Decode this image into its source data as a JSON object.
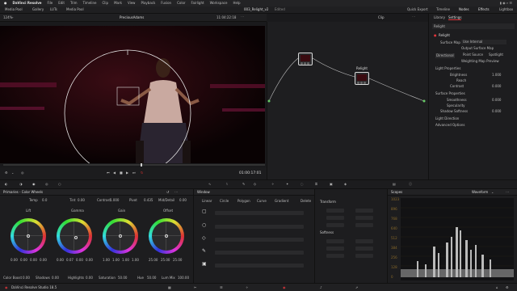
{
  "macbar": {
    "app_name": "DaVinci Resolve",
    "menus": [
      "File",
      "Edit",
      "Trim",
      "Timeline",
      "Clip",
      "Mark",
      "View",
      "Playback",
      "Fusion",
      "Color",
      "Fairlight",
      "Workspace",
      "Help"
    ]
  },
  "topbar": {
    "items": [
      "Media Pool",
      "Gallery",
      "LUTs",
      "Media Pool"
    ],
    "project_title": "003_Relight_v2",
    "project_status": "Edited",
    "right_tabs": [
      "Quick Export",
      "Timeline",
      "Nodes",
      "Effects",
      "Lightbox"
    ]
  },
  "viewer": {
    "zoom": "124%",
    "clip_name": "PreciousAdams",
    "timecode_top": "11:04:22:18",
    "mode": "Clip",
    "timecode": "01:00:17:01"
  },
  "right_panel": {
    "tabs": [
      "Library",
      "Settings"
    ],
    "search_label": "Relight",
    "section_title": "Relight",
    "surface_map_label": "Surface Map",
    "surface_map_value": "Use Internal",
    "output_surface_map": "Output Surface Map",
    "light_types": [
      "Directional",
      "Point Source",
      "Spotlight"
    ],
    "weighting_preview": "Weighting Map Preview",
    "light_properties": "Light Properties",
    "brightness_label": "Brightness",
    "brightness_value": "1.000",
    "reach_label": "Reach",
    "contrast_label": "Contrast",
    "contrast_value": "0.000",
    "surface_properties": "Surface Properties",
    "smoothness_label": "Smoothness",
    "smoothness_value": "0.000",
    "specularity_label": "Specularity",
    "shadow_softness_label": "Shadow Softness",
    "shadow_softness_value": "0.000",
    "light_direction": "Light Direction",
    "advanced_options": "Advanced Options"
  },
  "nodes": {
    "labels": [
      "01",
      "Relight",
      "02"
    ]
  },
  "primaries": {
    "title": "Primaries - Color Wheels",
    "temp_label": "Temp",
    "temp_value": "0.0",
    "tint_label": "Tint",
    "tint_value": "0.00",
    "contrast_label": "Contrast",
    "contrast_value": "1.000",
    "pivot_label": "Pivot",
    "pivot_value": "0.435",
    "middetail_label": "Mid/Detail",
    "middetail_value": "0.00",
    "wheels": [
      {
        "name": "Lift",
        "values": [
          "0.00",
          "0.00",
          "0.00",
          "0.00"
        ]
      },
      {
        "name": "Gamma",
        "values": [
          "0.00",
          "0.07",
          "0.00",
          "0.00"
        ]
      },
      {
        "name": "Gain",
        "values": [
          "1.00",
          "1.00",
          "1.00",
          "1.00"
        ]
      },
      {
        "name": "Offset",
        "values": [
          "25.00",
          "25.00",
          "25.00"
        ]
      }
    ],
    "bottom": [
      {
        "label": "Color Boost",
        "value": "0.00"
      },
      {
        "label": "Shadows",
        "value": "0.00"
      },
      {
        "label": "Highlights",
        "value": "0.00"
      },
      {
        "label": "Saturation",
        "value": "50.00"
      },
      {
        "label": "Hue",
        "value": "50.00"
      },
      {
        "label": "Lum Mix",
        "value": "100.00"
      }
    ]
  },
  "window_panel": {
    "title": "Window",
    "tools": [
      "Linear",
      "Circle",
      "Polygon",
      "Curve",
      "Gradient",
      "Delete"
    ],
    "transform_title": "Transform",
    "softness_title": "Softness",
    "transform_fields": [
      "Size",
      "Aspect",
      "Pan",
      "Tilt",
      "Rotate",
      "Opacity"
    ],
    "softness_fields": [
      "Soft 1",
      "Soft 2",
      "Soft 3",
      "Soft 4",
      "Inside",
      "Outside"
    ]
  },
  "scopes": {
    "title": "Scopes",
    "type": "Waveform",
    "scale": [
      "1023",
      "896",
      "768",
      "640",
      "512",
      "384",
      "256",
      "128",
      "0"
    ]
  },
  "dock": {
    "app_label": "DaVinci Resolve Studio 18.5"
  },
  "colors": {
    "accent": "#e0353b",
    "background": "#1d1d1f"
  }
}
